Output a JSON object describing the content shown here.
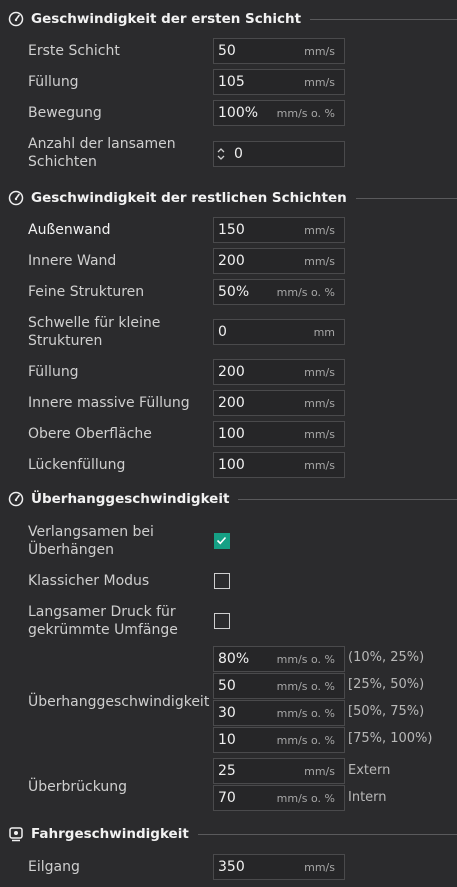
{
  "sections": {
    "first_layer": {
      "title": "Geschwindigkeit der ersten Schicht",
      "rows": [
        {
          "label": "Erste Schicht",
          "value": "50",
          "unit": "mm/s"
        },
        {
          "label": "Füllung",
          "value": "105",
          "unit": "mm/s"
        },
        {
          "label": "Bewegung",
          "value": "100%",
          "unit": "mm/s o. %"
        },
        {
          "label": "Anzahl der lansamen Schichten",
          "value": "0",
          "unit": ""
        }
      ]
    },
    "other_layers": {
      "title": "Geschwindigkeit der restlichen Schichten",
      "rows": [
        {
          "label": "Außenwand",
          "value": "150",
          "unit": "mm/s"
        },
        {
          "label": "Innere Wand",
          "value": "200",
          "unit": "mm/s"
        },
        {
          "label": "Feine Strukturen",
          "value": "50%",
          "unit": "mm/s o. %"
        },
        {
          "label": "Schwelle für kleine Strukturen",
          "value": "0",
          "unit": "mm"
        },
        {
          "label": "Füllung",
          "value": "200",
          "unit": "mm/s"
        },
        {
          "label": "Innere massive Füllung",
          "value": "200",
          "unit": "mm/s"
        },
        {
          "label": "Obere Oberfläche",
          "value": "100",
          "unit": "mm/s"
        },
        {
          "label": "Lückenfüllung",
          "value": "100",
          "unit": "mm/s"
        }
      ]
    },
    "overhang": {
      "title": "Überhanggeschwindigkeit",
      "checks": [
        {
          "label": "Verlangsamen bei Überhängen",
          "checked": true
        },
        {
          "label": "Klassicher Modus",
          "checked": false
        },
        {
          "label": "Langsamer Druck für gekrümmte Umfänge",
          "checked": false
        }
      ],
      "overhang_speed": {
        "label": "Überhanggeschwindigkeit",
        "fields": [
          {
            "value": "80%",
            "unit": "mm/s o. %",
            "range": "(10%, 25%)"
          },
          {
            "value": "50",
            "unit": "mm/s o. %",
            "range": "[25%, 50%)"
          },
          {
            "value": "30",
            "unit": "mm/s o. %",
            "range": "[50%, 75%)"
          },
          {
            "value": "10",
            "unit": "mm/s o. %",
            "range": "[75%, 100%)"
          }
        ]
      },
      "bridge": {
        "label": "Überbrückung",
        "fields": [
          {
            "value": "25",
            "unit": "mm/s",
            "range": "Extern"
          },
          {
            "value": "70",
            "unit": "mm/s o. %",
            "range": "Intern"
          }
        ]
      }
    },
    "travel": {
      "title": "Fahrgeschwindigkeit",
      "rows": [
        {
          "label": "Eilgang",
          "value": "350",
          "unit": "mm/s"
        }
      ]
    }
  },
  "colors": {
    "background": "#2b2b2d",
    "accent_check": "#16a085",
    "field_border": "#4a4a4c"
  },
  "icons": {
    "speed": "speedometer-icon",
    "travel": "travel-icon",
    "spinner": "spinner-arrows-icon",
    "check": "checkmark-icon"
  }
}
